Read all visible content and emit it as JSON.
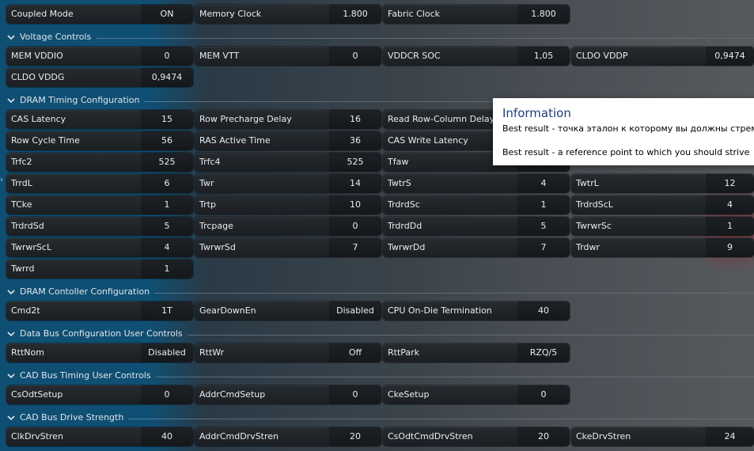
{
  "top": [
    {
      "label": "Coupled Mode",
      "value": "ON"
    },
    {
      "label": "Memory Clock",
      "value": "1.800"
    },
    {
      "label": "Fabric Clock",
      "value": "1.800"
    }
  ],
  "voltage": {
    "title": "Voltage Controls",
    "items": [
      {
        "label": "MEM VDDIO",
        "value": "0"
      },
      {
        "label": "MEM VTT",
        "value": "0"
      },
      {
        "label": "VDDCR SOC",
        "value": "1,05"
      },
      {
        "label": "CLDO VDDP",
        "value": "0,9474"
      },
      {
        "label": "CLDO VDDG",
        "value": "0,9474"
      }
    ]
  },
  "timing": {
    "title": "DRAM Timing Configuration",
    "items": [
      {
        "label": "CAS Latency",
        "value": "15"
      },
      {
        "label": "Row Precharge Delay",
        "value": "16"
      },
      {
        "label": "Read Row-Column Delay",
        "value": ""
      },
      {
        "label": "Row Cycle Time",
        "value": "56"
      },
      {
        "label": "RAS Active Time",
        "value": "36"
      },
      {
        "label": "CAS Write Latency",
        "value": ""
      },
      {
        "label": "Trfc2",
        "value": "525"
      },
      {
        "label": "Trfc4",
        "value": "525"
      },
      {
        "label": "Tfaw",
        "value": ""
      },
      {
        "label": "TrrdL",
        "value": "6"
      },
      {
        "label": "Twr",
        "value": "14"
      },
      {
        "label": "TwtrS",
        "value": "4"
      },
      {
        "label": "TwtrL",
        "value": "12"
      },
      {
        "label": "TCke",
        "value": "1"
      },
      {
        "label": "Trtp",
        "value": "10"
      },
      {
        "label": "TrdrdSc",
        "value": "1"
      },
      {
        "label": "TrdrdScL",
        "value": "4"
      },
      {
        "label": "TrdrdSd",
        "value": "5"
      },
      {
        "label": "Trcpage",
        "value": "0"
      },
      {
        "label": "TrdrdDd",
        "value": "5"
      },
      {
        "label": "TwrwrSc",
        "value": "1"
      },
      {
        "label": "TwrwrScL",
        "value": "4"
      },
      {
        "label": "TwrwrSd",
        "value": "7"
      },
      {
        "label": "TwrwrDd",
        "value": "7"
      },
      {
        "label": "Trdwr",
        "value": "9"
      },
      {
        "label": "Twrrd",
        "value": "1"
      }
    ]
  },
  "controller": {
    "title": "DRAM Contoller Configuration",
    "items": [
      {
        "label": "Cmd2t",
        "value": "1T"
      },
      {
        "label": "GearDownEn",
        "value": "Disabled"
      },
      {
        "label": "CPU On-Die Termination",
        "value": "40"
      }
    ]
  },
  "databus": {
    "title": "Data Bus Configuration User Controls",
    "items": [
      {
        "label": "RttNom",
        "value": "Disabled"
      },
      {
        "label": "RttWr",
        "value": "Off"
      },
      {
        "label": "RttPark",
        "value": "RZQ/5"
      }
    ]
  },
  "cadtiming": {
    "title": "CAD Bus Timing User Controls",
    "items": [
      {
        "label": "CsOdtSetup",
        "value": "0"
      },
      {
        "label": "AddrCmdSetup",
        "value": "0"
      },
      {
        "label": "CkeSetup",
        "value": "0"
      }
    ]
  },
  "caddrive": {
    "title": "CAD Bus Drive Strength",
    "items": [
      {
        "label": "ClkDrvStren",
        "value": "40"
      },
      {
        "label": "AddrCmdDrvStren",
        "value": "20"
      },
      {
        "label": "CsOdtCmdDrvStren",
        "value": "20"
      },
      {
        "label": "CkeDrvStren",
        "value": "24"
      }
    ]
  },
  "tooltip": {
    "title": "Information",
    "line_ru": "Best result - точка эталон к которому вы должны стремит",
    "line_en": "Best result - a reference point to which you should strive"
  }
}
